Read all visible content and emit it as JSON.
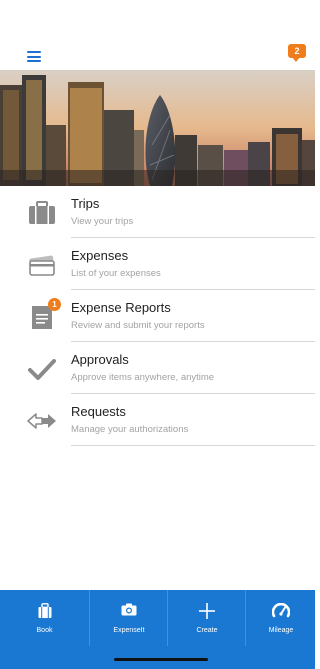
{
  "header": {
    "notification_count": "2"
  },
  "menu": [
    {
      "title": "Trips",
      "subtitle": "View your trips",
      "icon": "briefcase-icon"
    },
    {
      "title": "Expenses",
      "subtitle": "List of your expenses",
      "icon": "credit-card-icon"
    },
    {
      "title": "Expense Reports",
      "subtitle": "Review and submit your reports",
      "icon": "report-document-icon",
      "badge": "1"
    },
    {
      "title": "Approvals",
      "subtitle": "Approve items anywhere, anytime",
      "icon": "checkmark-icon"
    },
    {
      "title": "Requests",
      "subtitle": "Manage your authorizations",
      "icon": "arrows-exchange-icon"
    }
  ],
  "tabbar": [
    {
      "label": "Book",
      "icon": "briefcase-icon"
    },
    {
      "label": "ExpenseIt",
      "icon": "camera-icon"
    },
    {
      "label": "Create",
      "icon": "plus-icon"
    },
    {
      "label": "Mileage",
      "icon": "speedometer-icon"
    }
  ],
  "colors": {
    "accent": "#1a78d3",
    "notification": "#f07d1b",
    "icon_gray": "#8a8a8a"
  }
}
